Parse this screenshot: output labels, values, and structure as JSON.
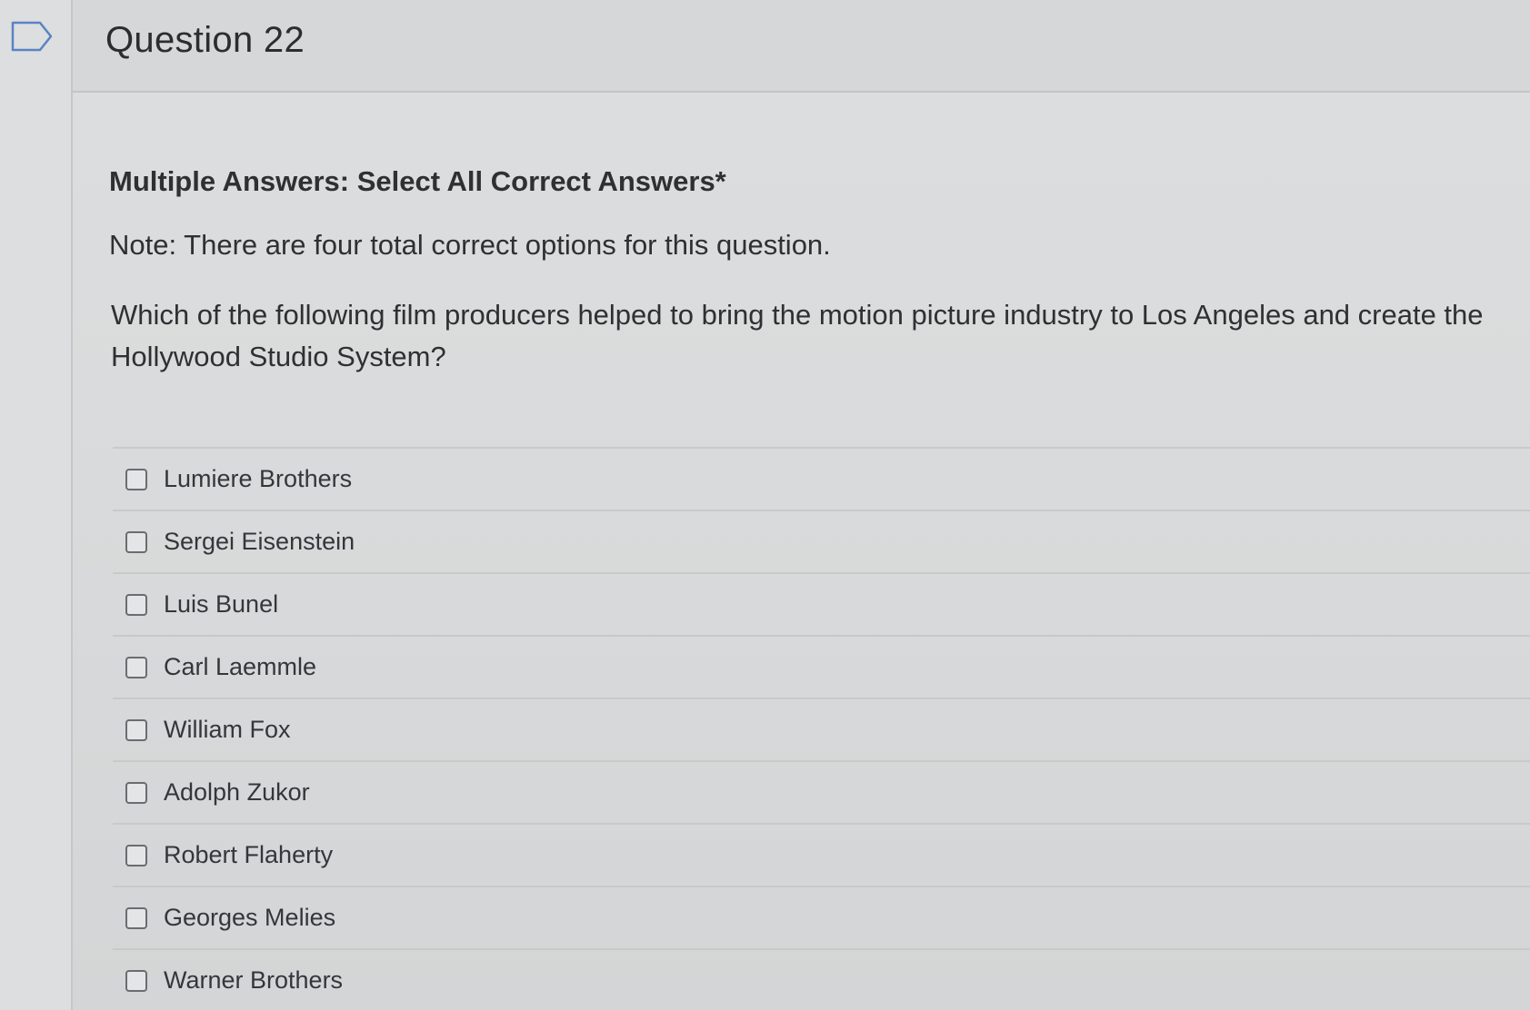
{
  "header": {
    "title": "Question 22",
    "flag_icon": "flag-outline-icon"
  },
  "question": {
    "instructions": "Multiple Answers: Select All Correct Answers*",
    "note": "Note: There are four total correct options for this question.",
    "text": "Which of the following film producers helped to bring the motion picture industry to Los Angeles and create the Hollywood Studio System?"
  },
  "answers": [
    {
      "label": "Lumiere Brothers",
      "checked": false
    },
    {
      "label": "Sergei Eisenstein",
      "checked": false
    },
    {
      "label": "Luis Bunel",
      "checked": false
    },
    {
      "label": "Carl Laemmle",
      "checked": false
    },
    {
      "label": "William Fox",
      "checked": false
    },
    {
      "label": "Adolph Zukor",
      "checked": false
    },
    {
      "label": "Robert Flaherty",
      "checked": false
    },
    {
      "label": "Georges Melies",
      "checked": false
    },
    {
      "label": "Warner Brothers",
      "checked": false
    }
  ]
}
